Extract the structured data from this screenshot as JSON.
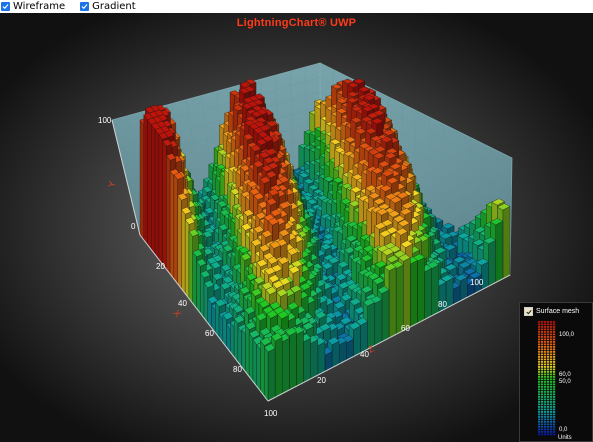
{
  "toolbar": {
    "wireframe": {
      "label": "Wireframe",
      "checked": true
    },
    "gradient": {
      "label": "Gradient",
      "checked": true
    }
  },
  "chart": {
    "title": "LightningChart® UWP",
    "title_color": "#ff3b1a"
  },
  "axes": {
    "y": {
      "title": "Y",
      "ticks": [
        "100",
        "0"
      ]
    },
    "x": {
      "title": "X",
      "ticks": [
        "0",
        "20",
        "40",
        "60",
        "80",
        "100"
      ]
    },
    "z": {
      "title": "Z",
      "ticks": [
        "100",
        "20",
        "40",
        "60",
        "80",
        "100"
      ]
    }
  },
  "legend": {
    "title": "Surface mesh",
    "checked": true,
    "labels": [
      "100,0",
      "60,0",
      "50,0",
      "0,0"
    ],
    "units": "Units",
    "gradient_stops": [
      {
        "value": 100,
        "color": "#b3120a"
      },
      {
        "value": 80,
        "color": "#e06010"
      },
      {
        "value": 60,
        "color": "#e8d020"
      },
      {
        "value": 50,
        "color": "#1fbf1f"
      },
      {
        "value": 20,
        "color": "#0a9f9a"
      },
      {
        "value": 0,
        "color": "#0a1aa8"
      }
    ]
  },
  "colors": {
    "accent": "#1a73e8",
    "axis_title": "#d9401e",
    "wall": "#7ab8c4"
  }
}
